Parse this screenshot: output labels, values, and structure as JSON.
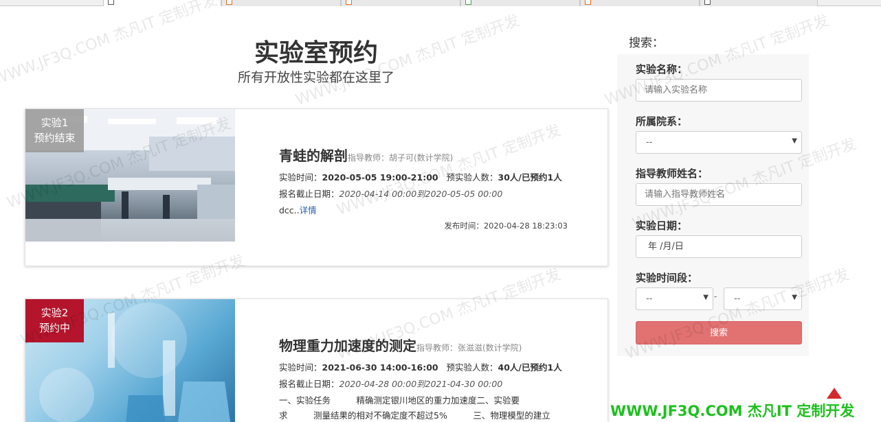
{
  "header": {
    "title": "实验室预约",
    "subtitle": "所有开放性实验都在这里了"
  },
  "labs": [
    {
      "badge_line1": "实验1",
      "badge_line2": "预约结束",
      "name": "青蛙的解剖",
      "teacher": "指导教师：胡子可(数计学院)",
      "time_label": "实验时间：",
      "time_value": "2020-05-05 19:00-21:00",
      "quota_label": "预实验人数：",
      "quota_value": "30人/已预约1人",
      "deadline_label": "报名截止日期：",
      "deadline_value": "2020-04-14 00:00到2020-05-05 00:00",
      "desc": "dcc..",
      "detail_link": "详情",
      "publish": "发布时间：2020-04-28 18:23:03"
    },
    {
      "badge_line1": "实验2",
      "badge_line2": "预约中",
      "name": "物理重力加速度的测定",
      "teacher": "指导教师：张滋滋(数计学院)",
      "time_label": "实验时间：",
      "time_value": "2021-06-30 14:00-16:00",
      "quota_label": "预实验人数：",
      "quota_value": "40人/已预约1人",
      "deadline_label": "报名截止日期：",
      "deadline_value": "2020-04-28 00:00到2021-04-30 00:00",
      "desc_line1": "一、实验任务　　　精确测定银川地区的重力加速度二、实验要",
      "desc_line2": "求　　　测量结果的相对不确定度不超过5%　　　三、物理模型的建立"
    }
  ],
  "search": {
    "heading": "搜索：",
    "name_label": "实验名称：",
    "name_placeholder": "请输入实验名称",
    "dept_label": "所属院系：",
    "dept_value": "--",
    "teacher_label": "指导教师姓名：",
    "teacher_placeholder": "请输入指导教师姓名",
    "date_label": "实验日期：",
    "date_placeholder": "年 /月/日",
    "period_label": "实验时间段：",
    "period_start": "--",
    "period_sep": "-",
    "period_end": "--",
    "button": "搜索"
  },
  "watermark": "WWW.JF3Q.COM 杰凡IT  定制开发",
  "brand": "WWW.JF3Q.COM 杰凡IT  定制开发",
  "colors": {
    "ended_badge": "#969696",
    "active_badge": "#b4142c",
    "search_button": "#e27272",
    "brand_green": "#1fbf1f"
  }
}
